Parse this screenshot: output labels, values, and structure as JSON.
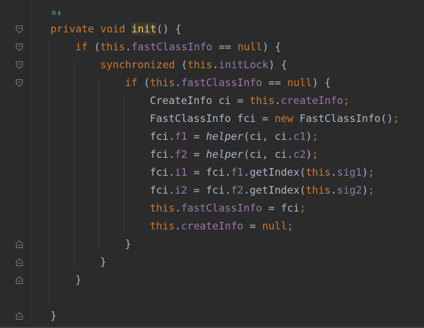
{
  "editor": {
    "hint": {
      "icon": "code-vision-icon",
      "text": "↡"
    },
    "colors": {
      "keyword": "#cc7832",
      "function": "#ffc66d",
      "field": "#9876aa",
      "text": "#a9b7c6",
      "background": "#2b2b2b"
    },
    "lines": [
      [
        {
          "t": "private ",
          "c": "kw"
        },
        {
          "t": "void ",
          "c": "kw"
        },
        {
          "t": "init",
          "c": "fnhl"
        },
        {
          "t": "() {",
          "c": "pl"
        }
      ],
      [
        {
          "t": "if ",
          "c": "kw"
        },
        {
          "t": "(",
          "c": "pl"
        },
        {
          "t": "this",
          "c": "kw"
        },
        {
          "t": ".",
          "c": "pl"
        },
        {
          "t": "fastClassInfo",
          "c": "field"
        },
        {
          "t": " == ",
          "c": "pl"
        },
        {
          "t": "null",
          "c": "kw"
        },
        {
          "t": ") {",
          "c": "pl"
        }
      ],
      [
        {
          "t": "synchronized ",
          "c": "kw"
        },
        {
          "t": "(",
          "c": "pl"
        },
        {
          "t": "this",
          "c": "kw"
        },
        {
          "t": ".",
          "c": "pl"
        },
        {
          "t": "initLock",
          "c": "field"
        },
        {
          "t": ") {",
          "c": "pl"
        }
      ],
      [
        {
          "t": "if ",
          "c": "kw"
        },
        {
          "t": "(",
          "c": "pl"
        },
        {
          "t": "this",
          "c": "kw"
        },
        {
          "t": ".",
          "c": "pl"
        },
        {
          "t": "fastClassInfo",
          "c": "field"
        },
        {
          "t": " == ",
          "c": "pl"
        },
        {
          "t": "null",
          "c": "kw"
        },
        {
          "t": ") {",
          "c": "pl"
        }
      ],
      [
        {
          "t": "CreateInfo ci = ",
          "c": "pl"
        },
        {
          "t": "this",
          "c": "kw"
        },
        {
          "t": ".",
          "c": "pl"
        },
        {
          "t": "createInfo",
          "c": "field"
        },
        {
          "t": ";",
          "c": "kw"
        }
      ],
      [
        {
          "t": "FastClassInfo fci = ",
          "c": "pl"
        },
        {
          "t": "new ",
          "c": "kw"
        },
        {
          "t": "FastClassInfo()",
          "c": "pl"
        },
        {
          "t": ";",
          "c": "kw"
        }
      ],
      [
        {
          "t": "fci.",
          "c": "pl"
        },
        {
          "t": "f1",
          "c": "field"
        },
        {
          "t": " = ",
          "c": "pl"
        },
        {
          "t": "helper",
          "c": "it"
        },
        {
          "t": "(ci, ci.",
          "c": "pl"
        },
        {
          "t": "c1",
          "c": "field"
        },
        {
          "t": ")",
          "c": "pl"
        },
        {
          "t": ";",
          "c": "kw"
        }
      ],
      [
        {
          "t": "fci.",
          "c": "pl"
        },
        {
          "t": "f2",
          "c": "field"
        },
        {
          "t": " = ",
          "c": "pl"
        },
        {
          "t": "helper",
          "c": "it"
        },
        {
          "t": "(ci, ci.",
          "c": "pl"
        },
        {
          "t": "c2",
          "c": "field"
        },
        {
          "t": ")",
          "c": "pl"
        },
        {
          "t": ";",
          "c": "kw"
        }
      ],
      [
        {
          "t": "fci.",
          "c": "pl"
        },
        {
          "t": "i1",
          "c": "field"
        },
        {
          "t": " = fci.",
          "c": "pl"
        },
        {
          "t": "f1",
          "c": "field"
        },
        {
          "t": ".getIndex(",
          "c": "pl"
        },
        {
          "t": "this",
          "c": "kw"
        },
        {
          "t": ".",
          "c": "pl"
        },
        {
          "t": "sig1",
          "c": "field"
        },
        {
          "t": ")",
          "c": "pl"
        },
        {
          "t": ";",
          "c": "kw"
        }
      ],
      [
        {
          "t": "fci.",
          "c": "pl"
        },
        {
          "t": "i2",
          "c": "field"
        },
        {
          "t": " = fci.",
          "c": "pl"
        },
        {
          "t": "f2",
          "c": "field"
        },
        {
          "t": ".getIndex(",
          "c": "pl"
        },
        {
          "t": "this",
          "c": "kw"
        },
        {
          "t": ".",
          "c": "pl"
        },
        {
          "t": "sig2",
          "c": "field"
        },
        {
          "t": ")",
          "c": "pl"
        },
        {
          "t": ";",
          "c": "kw"
        }
      ],
      [
        {
          "t": "this",
          "c": "kw"
        },
        {
          "t": ".",
          "c": "pl"
        },
        {
          "t": "fastClassInfo",
          "c": "field"
        },
        {
          "t": " = fci",
          "c": "pl"
        },
        {
          "t": ";",
          "c": "kw"
        }
      ],
      [
        {
          "t": "this",
          "c": "kw"
        },
        {
          "t": ".",
          "c": "pl"
        },
        {
          "t": "createInfo",
          "c": "field"
        },
        {
          "t": " = ",
          "c": "pl"
        },
        {
          "t": "null",
          "c": "kw"
        },
        {
          "t": ";",
          "c": "kw"
        }
      ],
      [
        {
          "t": "}",
          "c": "pl"
        }
      ],
      [
        {
          "t": "}",
          "c": "pl"
        }
      ],
      [
        {
          "t": "}",
          "c": "pl"
        }
      ],
      [],
      [
        {
          "t": "}",
          "c": "pl"
        }
      ]
    ]
  }
}
